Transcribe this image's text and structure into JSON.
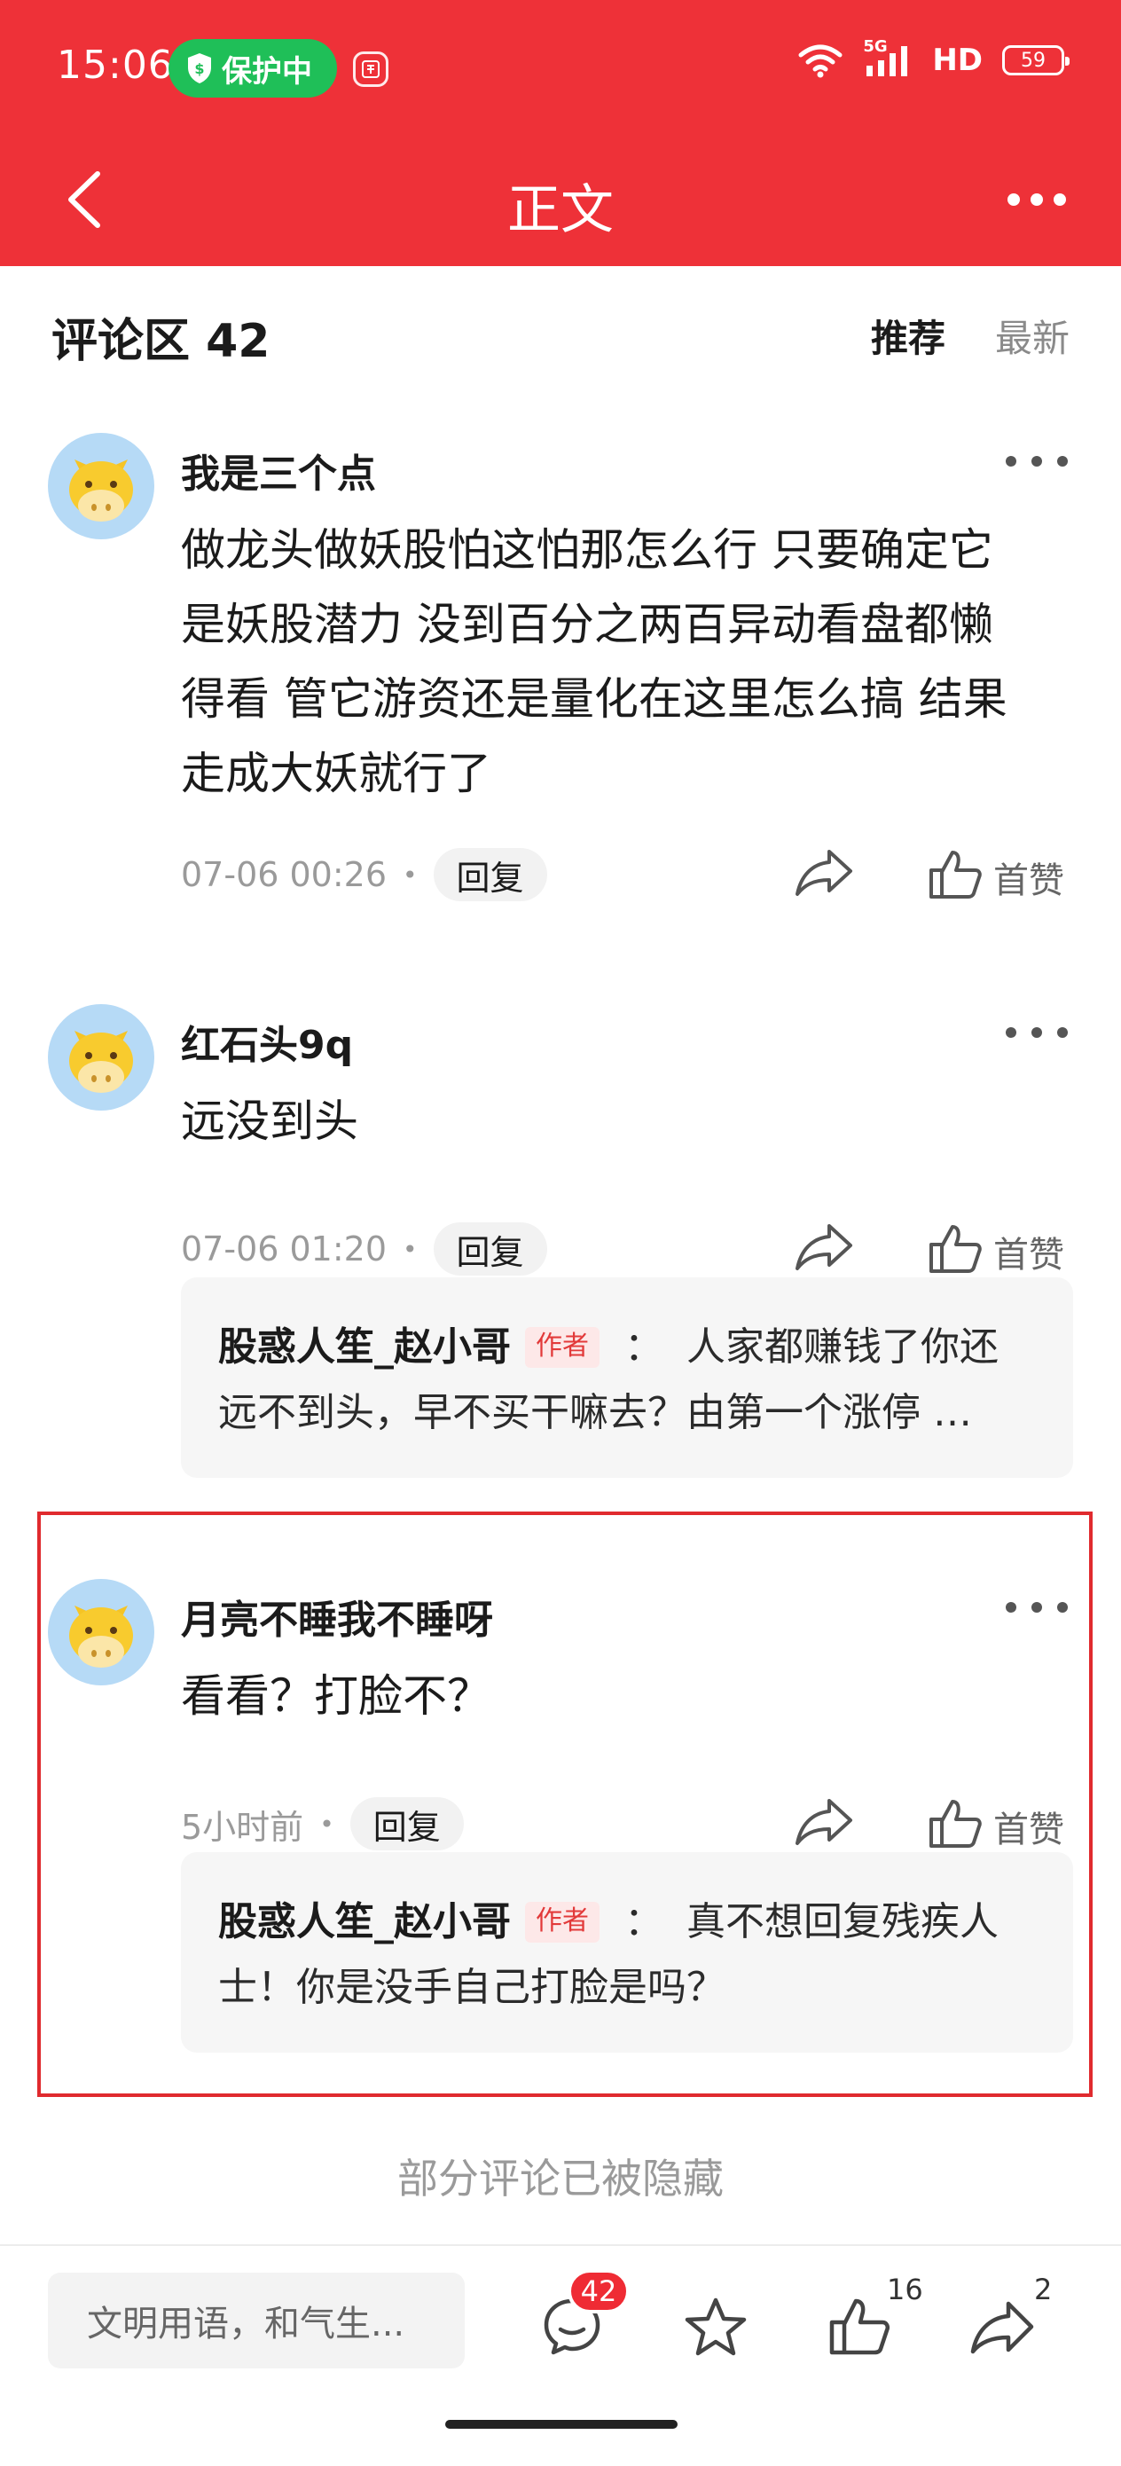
{
  "status_bar": {
    "time": "15:06",
    "protect_label": "保护中",
    "network": "5G",
    "hd": "HD",
    "battery": "59"
  },
  "title_bar": {
    "title": "正文"
  },
  "comments_header": {
    "title": "评论区 42",
    "tabs": [
      {
        "label": "推荐",
        "active": true
      },
      {
        "label": "最新",
        "active": false
      }
    ]
  },
  "comments": [
    {
      "username": "我是三个点",
      "lines": [
        "做龙头做妖股怕这怕那怎么行 只要确定它",
        "是妖股潜力 没到百分之两百异动看盘都懒",
        "得看 管它游资还是量化在这里怎么搞 结果",
        "走成大妖就行了"
      ],
      "time": "07-06 00:26",
      "reply_label": "回复",
      "like_label": "首赞"
    },
    {
      "username": "红石头9q",
      "lines": [
        "远没到头"
      ],
      "time": "07-06 01:20",
      "reply_label": "回复",
      "like_label": "首赞",
      "reply": {
        "author": "股惑人笙_赵小哥",
        "tag": "作者",
        "colon": "：",
        "line1": "人家都赚钱了你还",
        "line2": "远不到头，早不买干嘛去？由第一个涨停 …"
      }
    },
    {
      "username": "月亮不睡我不睡呀",
      "lines": [
        "看看？打脸不？"
      ],
      "time": "5小时前",
      "reply_label": "回复",
      "like_label": "首赞",
      "reply": {
        "author": "股惑人笙_赵小哥",
        "tag": "作者",
        "colon": "：",
        "line1": "真不想回复残疾人",
        "line2": "士！你是没手自己打脸是吗？"
      }
    }
  ],
  "hidden_note": "部分评论已被隐藏",
  "bottom_bar": {
    "input_placeholder": "文明用语，和气生...",
    "comment_count": "42",
    "like_count": "16",
    "share_count": "2"
  },
  "colors": {
    "brand_red": "#ee3138",
    "protect_green": "#1fbf58",
    "avatar_bg": "#b6daf6",
    "author_tag_text": "#e23a3a"
  }
}
